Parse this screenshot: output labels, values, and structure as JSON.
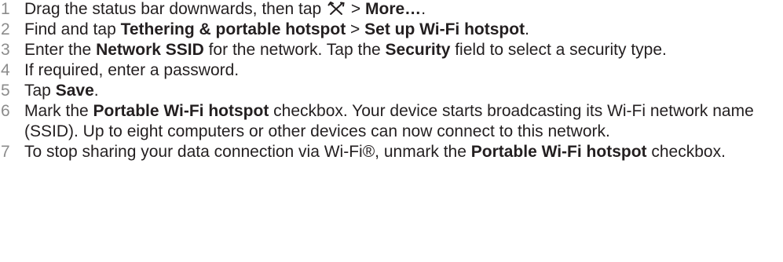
{
  "steps": [
    {
      "number": "1",
      "segments": [
        {
          "text": "Drag the status bar downwards, then tap "
        },
        {
          "icon": "tools-icon"
        },
        {
          "text": " > "
        },
        {
          "text": "More…",
          "bold": true
        },
        {
          "text": "."
        }
      ]
    },
    {
      "number": "2",
      "segments": [
        {
          "text": "Find and tap "
        },
        {
          "text": "Tethering & portable hotspot",
          "bold": true
        },
        {
          "text": " > "
        },
        {
          "text": "Set up Wi-Fi hotspot",
          "bold": true
        },
        {
          "text": "."
        }
      ]
    },
    {
      "number": "3",
      "segments": [
        {
          "text": "Enter the "
        },
        {
          "text": "Network SSID",
          "bold": true
        },
        {
          "text": " for the network. Tap the "
        },
        {
          "text": "Security",
          "bold": true
        },
        {
          "text": " field to select a security type."
        }
      ]
    },
    {
      "number": "4",
      "segments": [
        {
          "text": "If required, enter a password."
        }
      ]
    },
    {
      "number": "5",
      "segments": [
        {
          "text": "Tap "
        },
        {
          "text": "Save",
          "bold": true
        },
        {
          "text": "."
        }
      ]
    },
    {
      "number": "6",
      "segments": [
        {
          "text": "Mark the "
        },
        {
          "text": "Portable Wi-Fi hotspot",
          "bold": true
        },
        {
          "text": " checkbox. Your device starts broadcasting its Wi-Fi network name (SSID). Up to eight computers or other devices can now connect to this network."
        }
      ]
    },
    {
      "number": "7",
      "segments": [
        {
          "text": "To stop sharing your data connection via Wi-Fi®, unmark the "
        },
        {
          "text": "Portable Wi-Fi hotspot",
          "bold": true
        },
        {
          "text": " checkbox."
        }
      ]
    }
  ]
}
